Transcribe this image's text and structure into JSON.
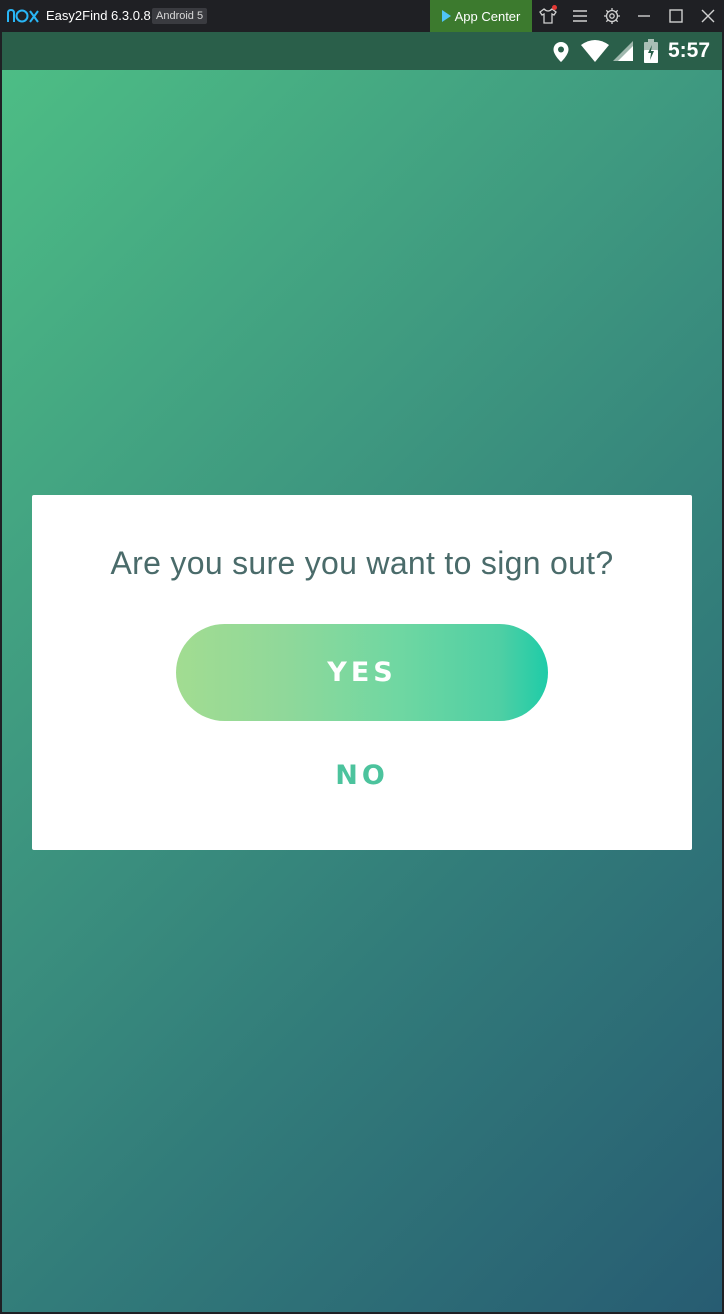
{
  "titlebar": {
    "app_title": "Easy2Find 6.3.0.8",
    "android_badge": "Android 5",
    "app_center_label": "App Center",
    "icons": [
      "nox-logo-icon",
      "shirt-icon",
      "menu-icon",
      "gear-icon",
      "minimize-icon",
      "maximize-icon",
      "close-icon"
    ],
    "colors": {
      "background": "#1f2024",
      "app_center_bg": "#3c7a2e",
      "notification_dot": "#e53935"
    }
  },
  "statusbar": {
    "time": "5:57",
    "icons": [
      "location-icon",
      "wifi-icon",
      "signal-icon",
      "battery-icon"
    ],
    "background": "#2a5f4a"
  },
  "dialog": {
    "message": "Are you sure you want to sign out?",
    "yes_label": "YES",
    "no_label": "NO",
    "colors": {
      "message": "#4a6b6a",
      "no_text": "#4cc39d",
      "yes_gradient_start": "#a2dc91",
      "yes_gradient_end": "#1ecca8"
    }
  },
  "screen": {
    "gradient_start": "#4dbd85",
    "gradient_end": "#275c72"
  }
}
